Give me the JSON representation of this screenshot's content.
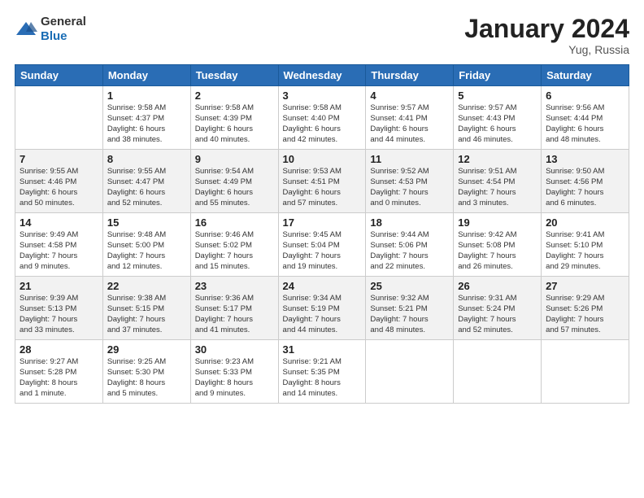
{
  "header": {
    "logo": {
      "text_general": "General",
      "text_blue": "Blue"
    },
    "title": "January 2024",
    "location": "Yug, Russia"
  },
  "weekdays": [
    "Sunday",
    "Monday",
    "Tuesday",
    "Wednesday",
    "Thursday",
    "Friday",
    "Saturday"
  ],
  "weeks": [
    [
      {
        "day": "",
        "info": ""
      },
      {
        "day": "1",
        "info": "Sunrise: 9:58 AM\nSunset: 4:37 PM\nDaylight: 6 hours\nand 38 minutes."
      },
      {
        "day": "2",
        "info": "Sunrise: 9:58 AM\nSunset: 4:39 PM\nDaylight: 6 hours\nand 40 minutes."
      },
      {
        "day": "3",
        "info": "Sunrise: 9:58 AM\nSunset: 4:40 PM\nDaylight: 6 hours\nand 42 minutes."
      },
      {
        "day": "4",
        "info": "Sunrise: 9:57 AM\nSunset: 4:41 PM\nDaylight: 6 hours\nand 44 minutes."
      },
      {
        "day": "5",
        "info": "Sunrise: 9:57 AM\nSunset: 4:43 PM\nDaylight: 6 hours\nand 46 minutes."
      },
      {
        "day": "6",
        "info": "Sunrise: 9:56 AM\nSunset: 4:44 PM\nDaylight: 6 hours\nand 48 minutes."
      }
    ],
    [
      {
        "day": "7",
        "info": "Sunrise: 9:55 AM\nSunset: 4:46 PM\nDaylight: 6 hours\nand 50 minutes."
      },
      {
        "day": "8",
        "info": "Sunrise: 9:55 AM\nSunset: 4:47 PM\nDaylight: 6 hours\nand 52 minutes."
      },
      {
        "day": "9",
        "info": "Sunrise: 9:54 AM\nSunset: 4:49 PM\nDaylight: 6 hours\nand 55 minutes."
      },
      {
        "day": "10",
        "info": "Sunrise: 9:53 AM\nSunset: 4:51 PM\nDaylight: 6 hours\nand 57 minutes."
      },
      {
        "day": "11",
        "info": "Sunrise: 9:52 AM\nSunset: 4:53 PM\nDaylight: 7 hours\nand 0 minutes."
      },
      {
        "day": "12",
        "info": "Sunrise: 9:51 AM\nSunset: 4:54 PM\nDaylight: 7 hours\nand 3 minutes."
      },
      {
        "day": "13",
        "info": "Sunrise: 9:50 AM\nSunset: 4:56 PM\nDaylight: 7 hours\nand 6 minutes."
      }
    ],
    [
      {
        "day": "14",
        "info": "Sunrise: 9:49 AM\nSunset: 4:58 PM\nDaylight: 7 hours\nand 9 minutes."
      },
      {
        "day": "15",
        "info": "Sunrise: 9:48 AM\nSunset: 5:00 PM\nDaylight: 7 hours\nand 12 minutes."
      },
      {
        "day": "16",
        "info": "Sunrise: 9:46 AM\nSunset: 5:02 PM\nDaylight: 7 hours\nand 15 minutes."
      },
      {
        "day": "17",
        "info": "Sunrise: 9:45 AM\nSunset: 5:04 PM\nDaylight: 7 hours\nand 19 minutes."
      },
      {
        "day": "18",
        "info": "Sunrise: 9:44 AM\nSunset: 5:06 PM\nDaylight: 7 hours\nand 22 minutes."
      },
      {
        "day": "19",
        "info": "Sunrise: 9:42 AM\nSunset: 5:08 PM\nDaylight: 7 hours\nand 26 minutes."
      },
      {
        "day": "20",
        "info": "Sunrise: 9:41 AM\nSunset: 5:10 PM\nDaylight: 7 hours\nand 29 minutes."
      }
    ],
    [
      {
        "day": "21",
        "info": "Sunrise: 9:39 AM\nSunset: 5:13 PM\nDaylight: 7 hours\nand 33 minutes."
      },
      {
        "day": "22",
        "info": "Sunrise: 9:38 AM\nSunset: 5:15 PM\nDaylight: 7 hours\nand 37 minutes."
      },
      {
        "day": "23",
        "info": "Sunrise: 9:36 AM\nSunset: 5:17 PM\nDaylight: 7 hours\nand 41 minutes."
      },
      {
        "day": "24",
        "info": "Sunrise: 9:34 AM\nSunset: 5:19 PM\nDaylight: 7 hours\nand 44 minutes."
      },
      {
        "day": "25",
        "info": "Sunrise: 9:32 AM\nSunset: 5:21 PM\nDaylight: 7 hours\nand 48 minutes."
      },
      {
        "day": "26",
        "info": "Sunrise: 9:31 AM\nSunset: 5:24 PM\nDaylight: 7 hours\nand 52 minutes."
      },
      {
        "day": "27",
        "info": "Sunrise: 9:29 AM\nSunset: 5:26 PM\nDaylight: 7 hours\nand 57 minutes."
      }
    ],
    [
      {
        "day": "28",
        "info": "Sunrise: 9:27 AM\nSunset: 5:28 PM\nDaylight: 8 hours\nand 1 minute."
      },
      {
        "day": "29",
        "info": "Sunrise: 9:25 AM\nSunset: 5:30 PM\nDaylight: 8 hours\nand 5 minutes."
      },
      {
        "day": "30",
        "info": "Sunrise: 9:23 AM\nSunset: 5:33 PM\nDaylight: 8 hours\nand 9 minutes."
      },
      {
        "day": "31",
        "info": "Sunrise: 9:21 AM\nSunset: 5:35 PM\nDaylight: 8 hours\nand 14 minutes."
      },
      {
        "day": "",
        "info": ""
      },
      {
        "day": "",
        "info": ""
      },
      {
        "day": "",
        "info": ""
      }
    ]
  ]
}
